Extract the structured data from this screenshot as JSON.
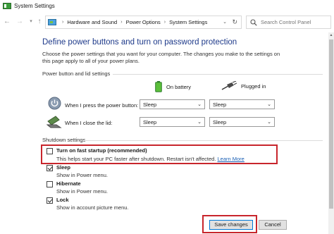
{
  "window": {
    "title": "System Settings"
  },
  "address": {
    "crumbs": [
      "Hardware and Sound",
      "Power Options",
      "System Settings"
    ],
    "separator": "›"
  },
  "search": {
    "placeholder": "Search Control Panel"
  },
  "main": {
    "heading": "Define power buttons and turn on password protection",
    "intro": "Choose the power settings that you want for your computer. The changes you make to the settings on this page apply to all of your power plans."
  },
  "power_section": {
    "label": "Power button and lid settings",
    "col_battery": "On battery",
    "col_plugged": "Plugged in",
    "rows": [
      {
        "label": "When I press the power button:",
        "battery": "Sleep",
        "plugged": "Sleep"
      },
      {
        "label": "When I close the lid:",
        "battery": "Sleep",
        "plugged": "Sleep"
      }
    ]
  },
  "shutdown_section": {
    "label": "Shutdown settings",
    "items": [
      {
        "title": "Turn on fast startup (recommended)",
        "desc": "This helps start your PC faster after shutdown. Restart isn't affected.",
        "link": "Learn More",
        "checked": false
      },
      {
        "title": "Sleep",
        "desc": "Show in Power menu.",
        "checked": true
      },
      {
        "title": "Hibernate",
        "desc": "Show in Power menu.",
        "checked": false
      },
      {
        "title": "Lock",
        "desc": "Show in account picture menu.",
        "checked": true
      }
    ]
  },
  "buttons": {
    "save": "Save changes",
    "cancel": "Cancel"
  },
  "icons": {
    "app": "power-options-icon",
    "back": "back-arrow-icon",
    "forward": "forward-arrow-icon",
    "up": "up-arrow-icon",
    "refresh": "refresh-icon",
    "search": "search-icon",
    "battery": "battery-icon",
    "plug": "plug-icon",
    "power_button": "power-button-icon",
    "lid": "laptop-lid-icon"
  },
  "colors": {
    "heading": "#1e3a8a",
    "highlight": "#c8252c",
    "link": "#1a5fb4"
  }
}
